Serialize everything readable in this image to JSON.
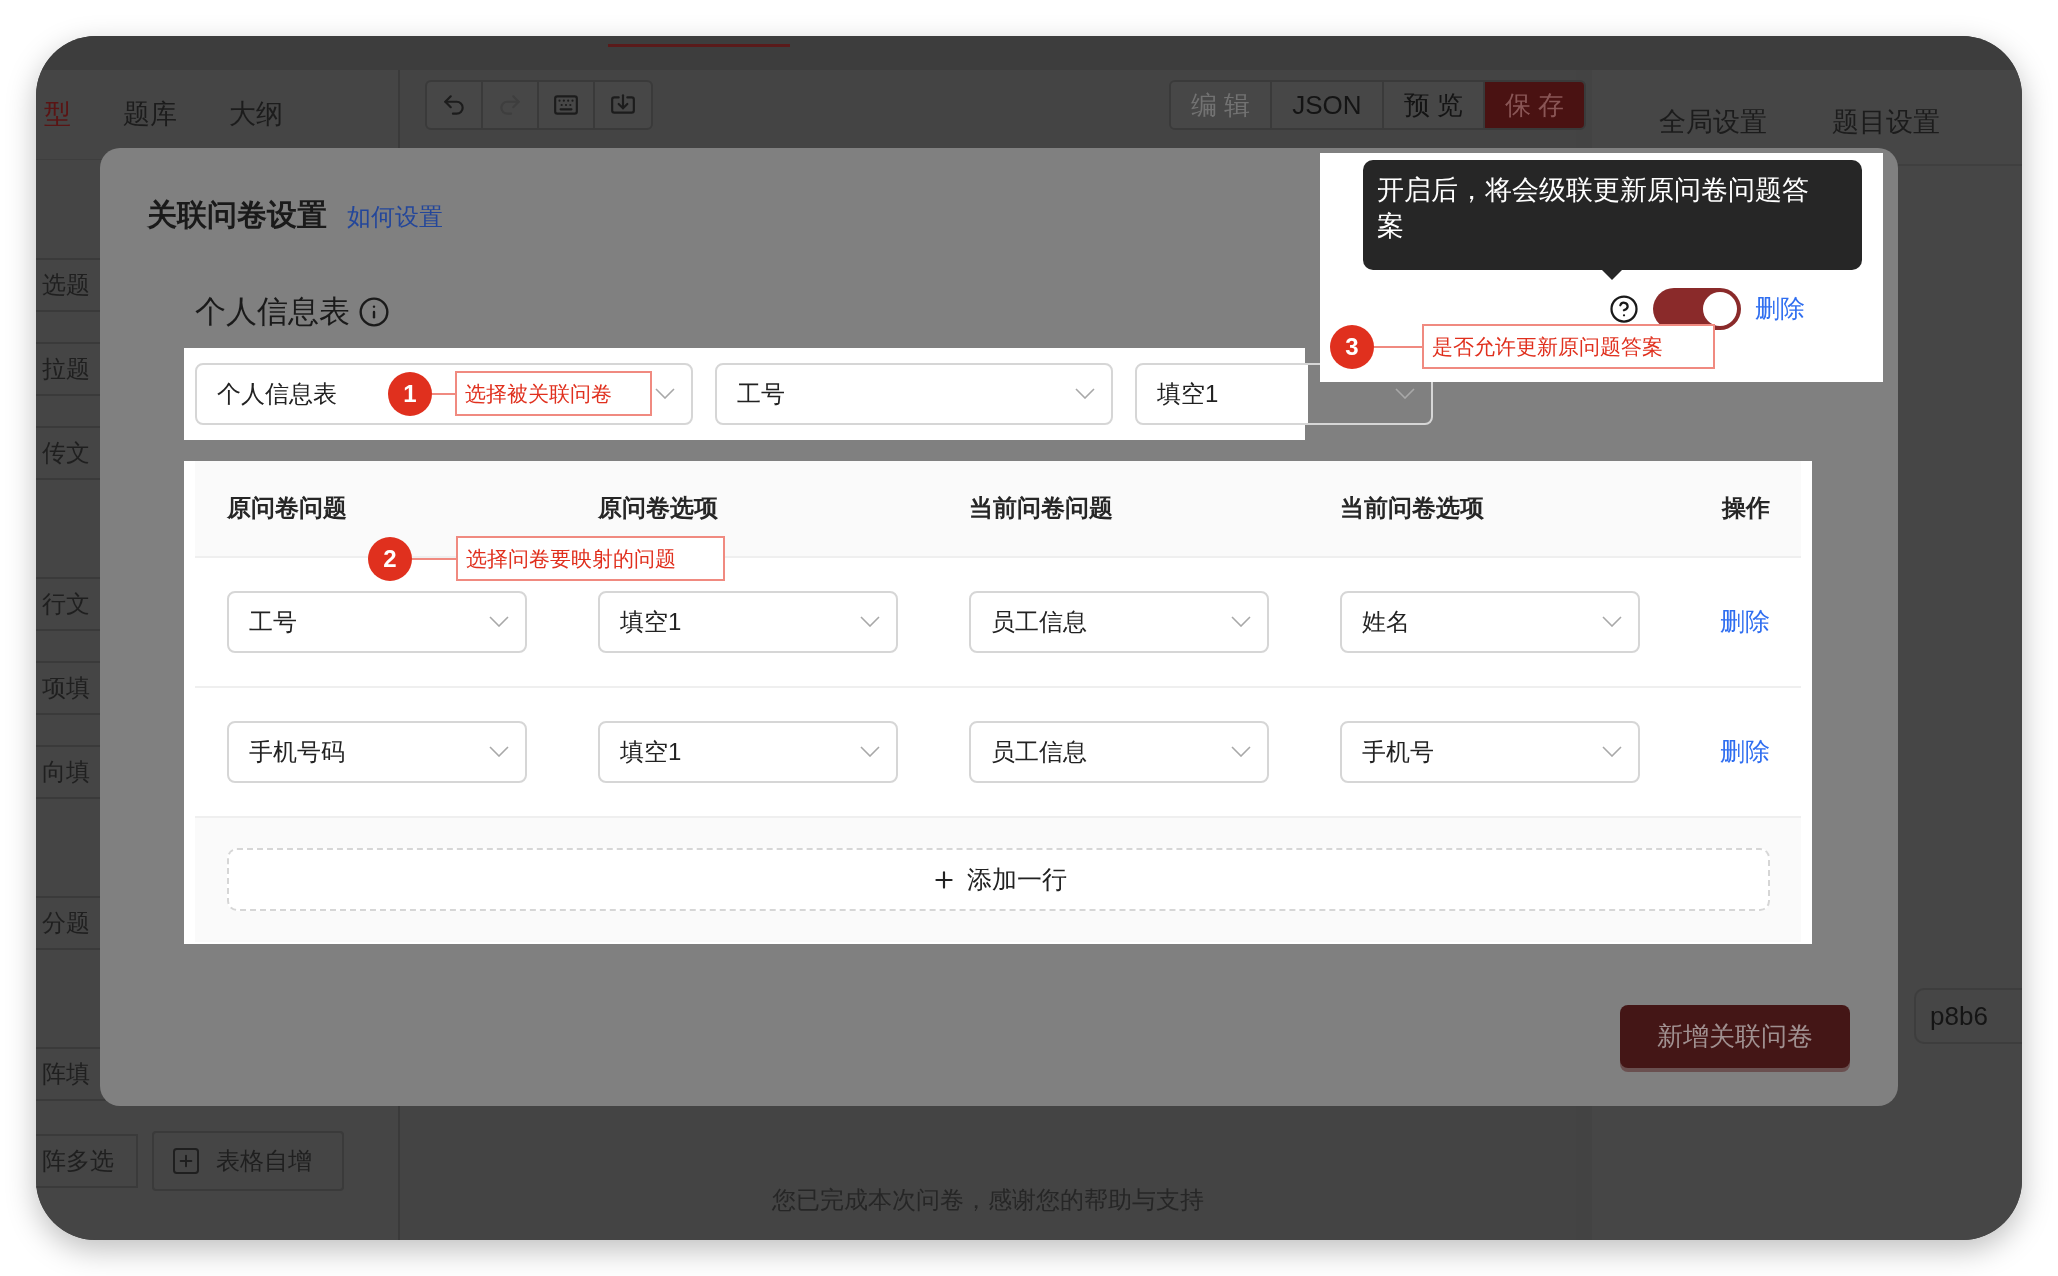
{
  "sidebar_tabs": [
    {
      "label": "型",
      "selected": true
    },
    {
      "label": "题库",
      "selected": false
    },
    {
      "label": "大纲",
      "selected": false
    }
  ],
  "component_groups": [
    [
      {
        "label": "选题",
        "kind": "item"
      }
    ],
    [
      {
        "label": "拉题",
        "kind": "item"
      }
    ],
    [
      {
        "label": "传文",
        "kind": "item"
      }
    ],
    [
      {
        "label": "行文",
        "kind": "item"
      }
    ],
    [
      {
        "label": "项填",
        "kind": "item"
      }
    ],
    [
      {
        "label": "向填",
        "kind": "item"
      }
    ],
    [
      {
        "label": "分题",
        "kind": "item"
      }
    ],
    [
      {
        "label": "阵填",
        "kind": "item"
      }
    ],
    [
      {
        "label": "阵多选",
        "kind": "item"
      },
      {
        "label": "表格自增",
        "kind": "tool"
      }
    ]
  ],
  "history_tools": [
    {
      "kind": "undo",
      "disabled": false
    },
    {
      "kind": "redo",
      "disabled": true
    },
    {
      "kind": "keyboard",
      "disabled": false
    },
    {
      "kind": "import",
      "disabled": false
    }
  ],
  "mode_buttons": [
    {
      "label": "编 辑",
      "kind": "default",
      "disabled": true
    },
    {
      "label": "JSON",
      "kind": "default",
      "disabled": false
    },
    {
      "label": "预 览",
      "kind": "default",
      "disabled": false
    },
    {
      "label": "保 存",
      "kind": "primary",
      "disabled": false
    }
  ],
  "canvas": {
    "footer_text": "您已完成本次问卷，感谢您的帮助与支持"
  },
  "right_panel": {
    "tabs": [
      {
        "label": "全局设置",
        "selected": false
      },
      {
        "label": "题目设置",
        "selected": false
      }
    ],
    "field_value": "p8b6"
  },
  "modal": {
    "title": "关联问卷设置",
    "help_link": "如何设置",
    "survey_title": "个人信息表",
    "survey_selects": [
      "个人信息表",
      "工号",
      "填空1"
    ],
    "table": {
      "columns": [
        "原问卷问题",
        "原问卷选项",
        "当前问卷问题",
        "当前问卷选项",
        "操作"
      ],
      "rows": [
        {
          "cells": [
            "工号",
            "填空1",
            "员工信息",
            "姓名"
          ],
          "action": "删除"
        },
        {
          "cells": [
            "手机号码",
            "填空1",
            "员工信息",
            "手机号"
          ],
          "action": "删除"
        }
      ]
    },
    "add_row": "添加一行",
    "tooltip": "开启后，将会级联更新原问卷问题答案",
    "update_toggle": {
      "on": true
    },
    "toggle_delete": "删除",
    "add_button": "新增关联问卷"
  },
  "callouts": [
    {
      "number": "1",
      "text": "选择被关联问卷"
    },
    {
      "number": "2",
      "text": "选择问卷要映射的问题"
    },
    {
      "number": "3",
      "text": "是否允许更新原问题答案"
    }
  ]
}
